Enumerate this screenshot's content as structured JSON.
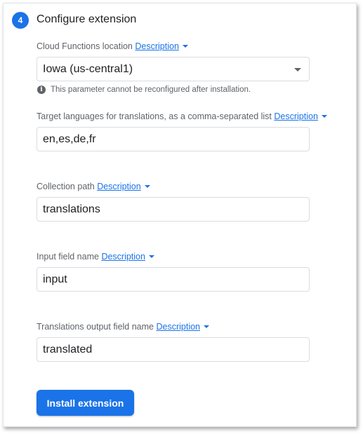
{
  "step": {
    "number": "4",
    "title": "Configure extension"
  },
  "fields": [
    {
      "label": "Cloud Functions location",
      "link": "Description",
      "value": "Iowa (us-central1)",
      "hint": "This parameter cannot be reconfigured after installation."
    },
    {
      "label": "Target languages for translations, as a comma-separated list",
      "link": "Description",
      "value": "en,es,de,fr"
    },
    {
      "label": "Collection path",
      "link": "Description",
      "value": "translations"
    },
    {
      "label": "Input field name",
      "link": "Description",
      "value": "input"
    },
    {
      "label": "Translations output field name",
      "link": "Description",
      "value": "translated"
    }
  ],
  "actions": {
    "install_label": "Install extension"
  },
  "icons": {
    "info": "info-icon",
    "caret": "caret-down-icon",
    "dropdown": "dropdown-arrow-icon"
  },
  "colors": {
    "accent": "#1a73e8",
    "text_primary": "#202124",
    "text_secondary": "#5f6368",
    "border": "#dadce0"
  }
}
